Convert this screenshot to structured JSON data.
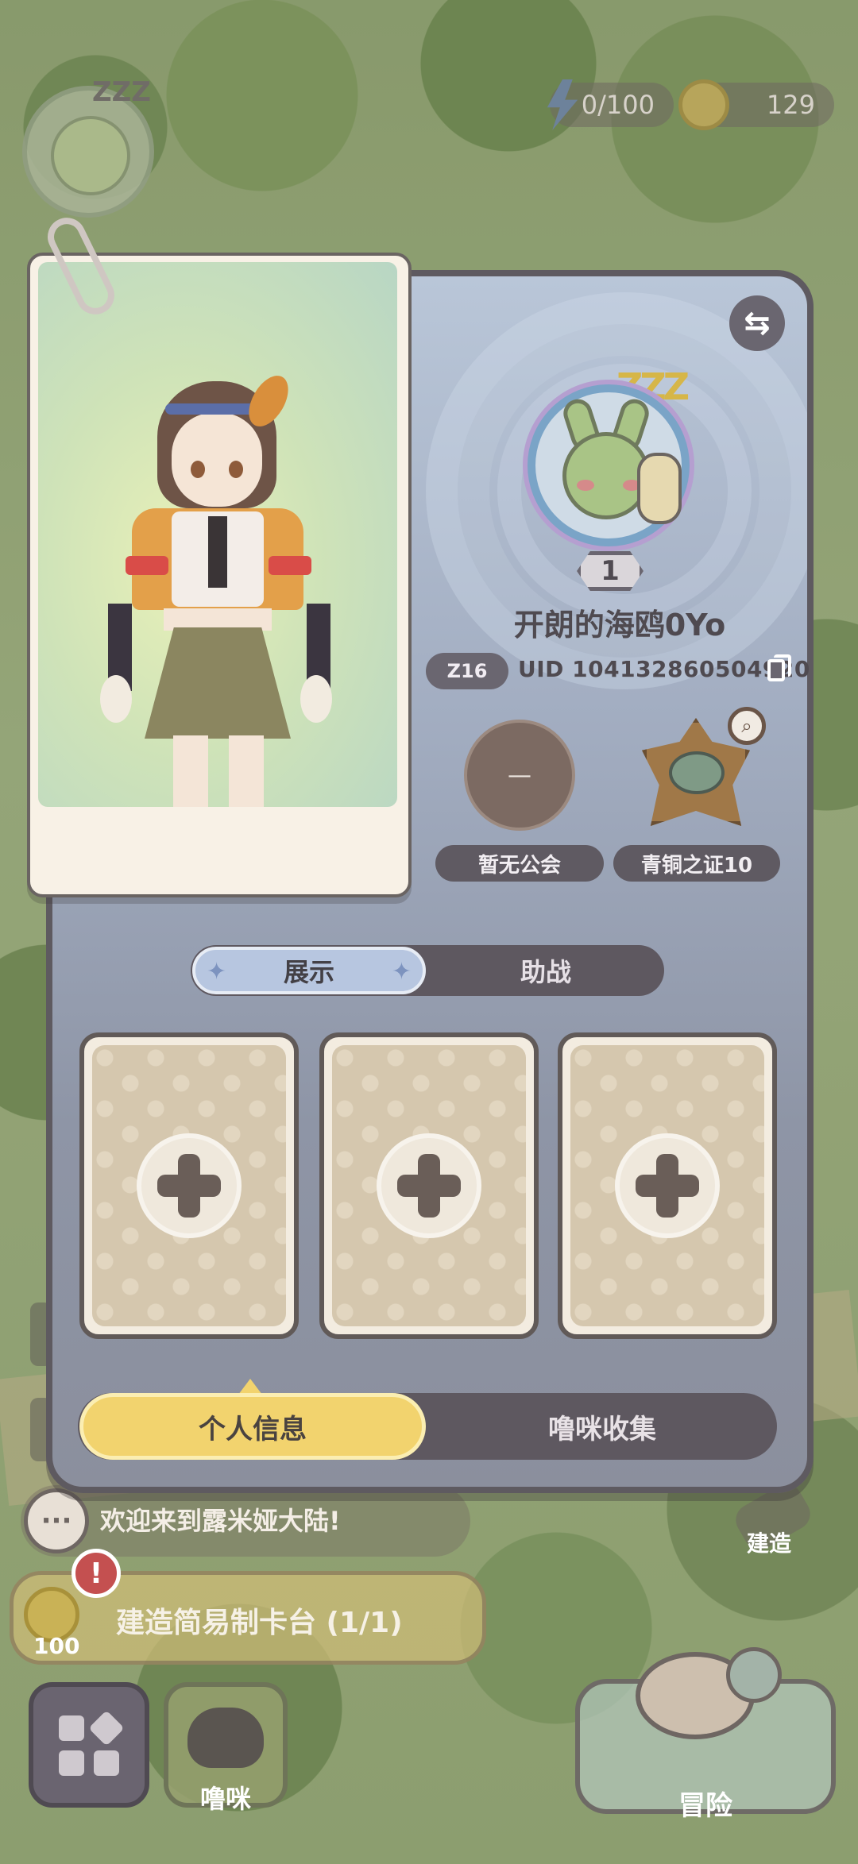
{
  "hud": {
    "energy": "0/100",
    "coins": "129"
  },
  "profile": {
    "level": "1",
    "name": "开朗的海鸥0Yo",
    "server": "Z16",
    "uid": "UID 104132860504920",
    "guild_placeholder": "—",
    "guild_label": "暂无公会",
    "badge_label": "青铜之证10"
  },
  "tabs": {
    "display": "展示",
    "assist": "助战"
  },
  "slots": [
    {
      "state": "empty"
    },
    {
      "state": "empty"
    },
    {
      "state": "empty"
    }
  ],
  "bottom_tabs": {
    "personal_info": "个人信息",
    "pet_collection": "噜咪收集"
  },
  "background_ui": {
    "chat_message": "欢迎来到露米娅大陆!",
    "quest_text": "建造简易制卡台 (1/1)",
    "quest_reward": "100",
    "quest_alert": "!",
    "build_label": "建造",
    "pet_label": "噜咪",
    "adventure_label": "冒险"
  },
  "colors": {
    "panel_top": "#b9c6d8",
    "panel_bottom": "#8b8f9d",
    "active_bottom_tab": "#f2d36e",
    "active_tab": "#b7c6e0"
  },
  "icons": {
    "swap": "swap-icon",
    "copy": "copy-icon",
    "magnify": "magnifier-icon",
    "energy": "lightning-icon",
    "coin": "coin-icon",
    "add": "plus-icon",
    "menu": "grid-menu-icon",
    "chat": "chat-bubble-icon"
  }
}
